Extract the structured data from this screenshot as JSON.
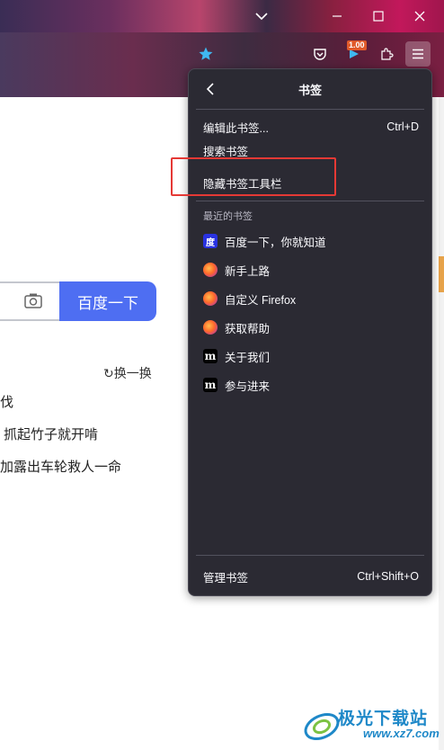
{
  "window": {
    "minimize_icon": "minimize-icon",
    "maximize_icon": "maximize-icon",
    "close_icon": "close-icon",
    "tabs_dropdown_icon": "chevron-down-icon"
  },
  "toolbar": {
    "extension_badge": "1.00"
  },
  "page": {
    "search_button": "百度一下",
    "refresh_label": "换一换",
    "news": [
      "伐",
      "抓起竹子就开啃",
      "加露出车轮救人一命"
    ]
  },
  "panel": {
    "title": "书签",
    "items": [
      {
        "label": "编辑此书签...",
        "shortcut": "Ctrl+D"
      },
      {
        "label": "搜索书签",
        "shortcut": ""
      },
      {
        "label": "隐藏书签工具栏",
        "shortcut": ""
      }
    ],
    "recent_label": "最近的书签",
    "bookmarks": [
      {
        "label": "百度一下，你就知道",
        "icon": "baidu-icon"
      },
      {
        "label": "新手上路",
        "icon": "firefox-icon"
      },
      {
        "label": "自定义 Firefox",
        "icon": "firefox-icon"
      },
      {
        "label": "获取帮助",
        "icon": "firefox-icon"
      },
      {
        "label": "关于我们",
        "icon": "mozilla-icon"
      },
      {
        "label": "参与进来",
        "icon": "mozilla-icon"
      }
    ],
    "manage": {
      "label": "管理书签",
      "shortcut": "Ctrl+Shift+O"
    }
  },
  "watermark": {
    "name": "极光下载站",
    "url": "www.xz7.com"
  },
  "colors": {
    "accent": "#4e6ef2",
    "panel_bg": "#2b2a33",
    "highlight": "#e53935"
  }
}
